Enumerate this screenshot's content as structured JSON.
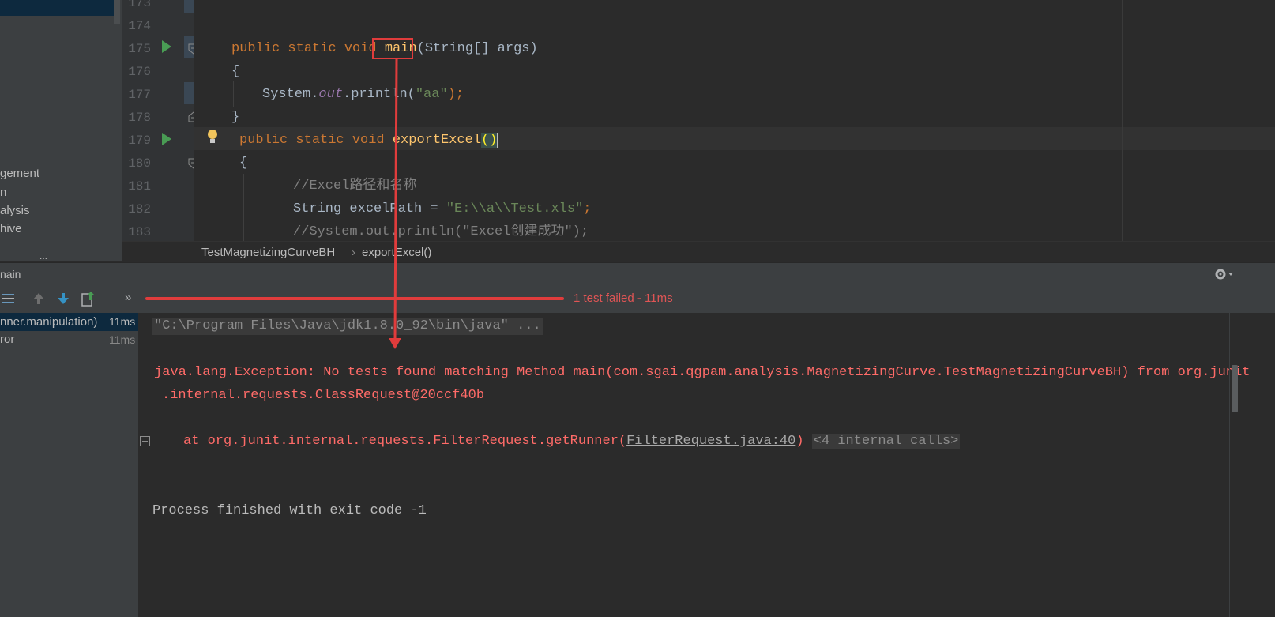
{
  "sidebar": {
    "items": [
      {
        "label": "gement"
      },
      {
        "label": "n"
      },
      {
        "label": "alysis"
      },
      {
        "label": "hive"
      },
      {
        "label": "..."
      }
    ]
  },
  "editor": {
    "line_numbers": [
      "173",
      "174",
      "175",
      "176",
      "177",
      "178",
      "179",
      "180",
      "181",
      "182",
      "183"
    ],
    "lines": {
      "l175": {
        "kw": "public static void ",
        "name": "main",
        "rest": "(String[] args)"
      },
      "l176": "{",
      "l177": {
        "pre": "System.",
        "field": "out",
        "mid": ".println(",
        "str": "\"aa\"",
        "end": ");"
      },
      "l178": "}",
      "l179": {
        "kw": "public static void ",
        "name": "exportExcel",
        "paren": "()"
      },
      "l180": "{",
      "l181": "//Excel路径和名称",
      "l182": {
        "pre": "String excelPath = ",
        "str": "\"E:\\\\a\\\\Test.xls\"",
        "end": ";"
      },
      "l183": "//System.out.println(\"Excel创建成功\");"
    }
  },
  "breadcrumb": {
    "class_name": "TestMagnetizingCurveBH",
    "method_name": "exportExcel()"
  },
  "run_panel": {
    "title": "nain",
    "status": "1 test failed - 11ms",
    "tree": [
      {
        "label": "nner.manipulation)",
        "time": "11ms"
      },
      {
        "label": "ror",
        "time": "11ms"
      }
    ]
  },
  "console": {
    "command": "\"C:\\Program Files\\Java\\jdk1.8.0_92\\bin\\java\" ...",
    "exception_line1": "java.lang.Exception: No tests found matching Method main(com.sgai.qgpam.analysis.MagnetizingCurve.TestMagnetizingCurveBH) from org.junit",
    "exception_line2": ".internal.requests.ClassRequest@20ccf40b",
    "stack_prefix": "at org.junit.internal.requests.FilterRequest.getRunner(",
    "stack_link": "FilterRequest.java:40",
    "stack_suffix": ")",
    "internal_calls": "<4 internal calls>",
    "exit": "Process finished with exit code -1"
  },
  "colors": {
    "annotation_red": "#e03c3c",
    "error_text": "#ff6b68",
    "status_text": "#e05555"
  },
  "icons": [
    "run-gutter-icon",
    "fold-icon",
    "lightbulb-icon",
    "collapse-all-icon",
    "arrow-up-icon",
    "arrow-down-icon",
    "export-icon",
    "more-icon",
    "gear-icon",
    "expand-plus-icon"
  ]
}
